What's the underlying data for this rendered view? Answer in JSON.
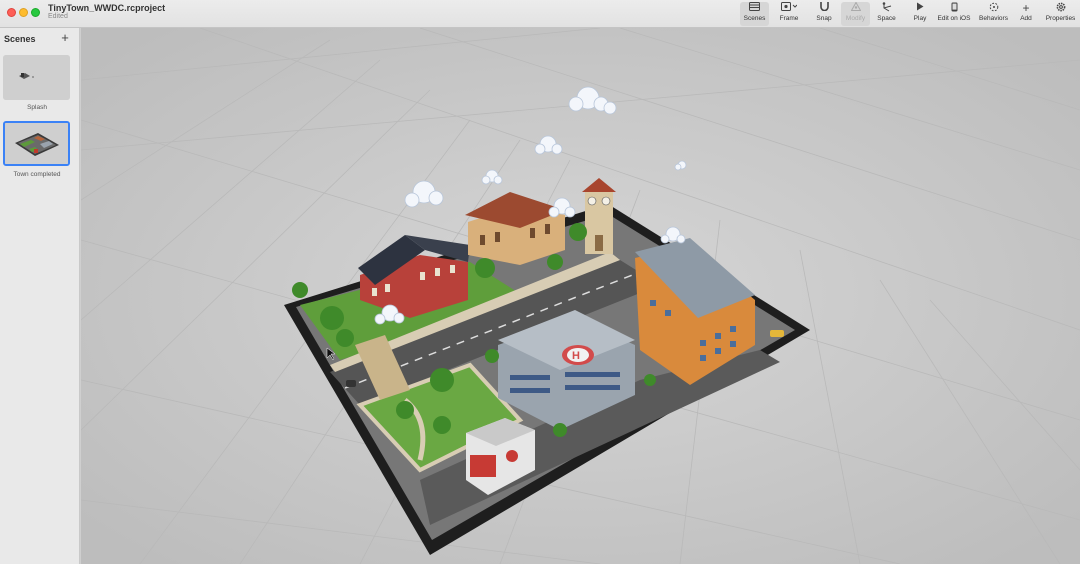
{
  "window": {
    "title": "TinyTown_WWDC.rcproject",
    "status": "Edited"
  },
  "toolbar": {
    "items": [
      {
        "label": "Scenes",
        "icon": "sidebar-icon"
      },
      {
        "label": "Frame",
        "icon": "frame-icon"
      },
      {
        "label": "Snap",
        "icon": "magnet-icon"
      },
      {
        "label": "Modify",
        "icon": "modify-icon"
      },
      {
        "label": "Space",
        "icon": "space-icon"
      },
      {
        "label": "Play",
        "icon": "play-icon"
      },
      {
        "label": "Edit on iOS",
        "icon": "phone-icon"
      },
      {
        "label": "Behaviors",
        "icon": "behaviors-icon"
      },
      {
        "label": "Add",
        "icon": "plus-icon"
      },
      {
        "label": "Properties",
        "icon": "gear-icon"
      }
    ]
  },
  "sidebar": {
    "title": "Scenes",
    "scenes": [
      {
        "name": "Splash",
        "selected": false
      },
      {
        "name": "Town completed",
        "selected": true
      }
    ]
  },
  "viewport": {
    "scene": "Town completed"
  }
}
